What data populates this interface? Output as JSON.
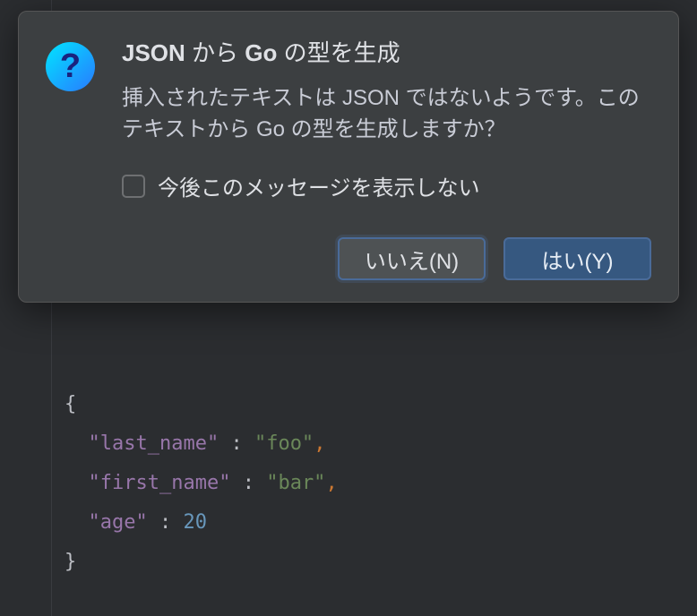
{
  "dialog": {
    "title_strong1": "JSON",
    "title_mid": " から ",
    "title_strong2": "Go",
    "title_tail": " の型を生成",
    "message": "挿入されたテキストは JSON ではないようです。このテキストから Go の型を生成しますか？",
    "checkbox_label": "今後このメッセージを表示しない",
    "no_button": "いいえ(N)",
    "yes_button": "はい(Y)"
  },
  "code": {
    "open_brace": "{",
    "line1_key": "\"last_name\"",
    "line1_val": "\"foo\"",
    "line2_key": "\"first_name\"",
    "line2_val": "\"bar\"",
    "line3_key": "\"age\"",
    "line3_val": "20",
    "close_brace": "}",
    "colon": " : ",
    "comma": ","
  }
}
